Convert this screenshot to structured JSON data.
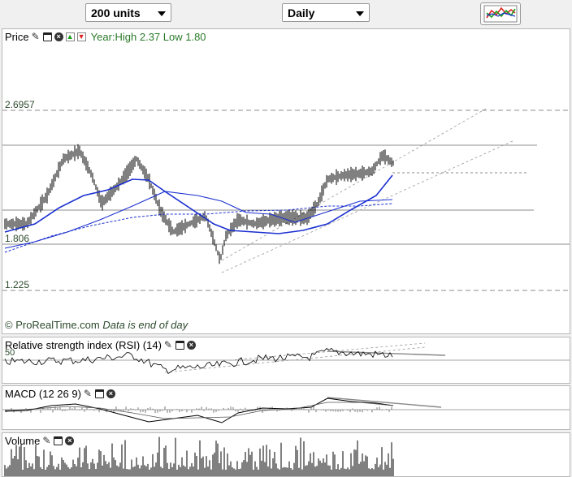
{
  "toolbar": {
    "units_select": "200 units",
    "period_select": "Daily",
    "chart_type_button": "chart-type-icon"
  },
  "price_panel": {
    "title": "Price",
    "year_range": "Year:High 2.37 Low 1.80",
    "levels": [
      "2.6957",
      "1.806",
      "1.225"
    ],
    "credit": "© ProRealTime.com",
    "credit_note": "Data is end of day"
  },
  "rsi_panel": {
    "title": "Relative strength index (RSI) (14)",
    "axis_label": "50"
  },
  "macd_panel": {
    "title": "MACD (12 26 9)"
  },
  "volume_panel": {
    "title": "Volume"
  },
  "colors": {
    "price_bars": "#000000",
    "moving_average_short": "#1a2fd0",
    "moving_average_long": "#1a2fd0",
    "horizontal_lines": "#666666",
    "channel_lines": "#999999",
    "credit_text": "#2d4a2d",
    "year_text": "#2a7a2a"
  },
  "icons": [
    "wrench-icon",
    "window-icon",
    "close-icon",
    "move-up-icon",
    "move-down-icon",
    "chevron-down-icon"
  ]
}
